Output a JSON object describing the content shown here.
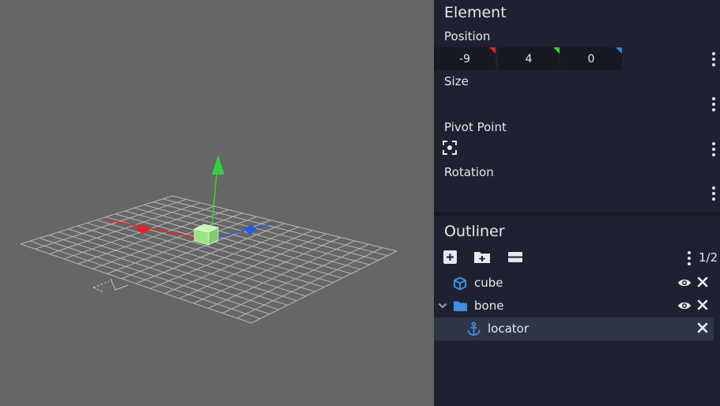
{
  "element_panel": {
    "title": "Element",
    "position": {
      "label": "Position",
      "x": "-9",
      "y": "4",
      "z": "0",
      "x_color": "#e0242d",
      "y_color": "#33d13f",
      "z_color": "#1f8fe6"
    },
    "size": {
      "label": "Size"
    },
    "pivot": {
      "label": "Pivot Point",
      "icon": "focus-pivot-icon"
    },
    "rotation": {
      "label": "Rotation"
    }
  },
  "outliner": {
    "title": "Outliner",
    "tools": [
      "add-cube-icon",
      "add-group-icon",
      "collapse-all-icon"
    ],
    "page_count": "1/2",
    "items": [
      {
        "label": "cube",
        "icon": "cube-icon",
        "visible": true
      },
      {
        "label": "bone",
        "icon": "folder-icon",
        "expanded": true,
        "visible": true
      },
      {
        "label": "locator",
        "icon": "anchor-icon",
        "selected": true
      }
    ]
  },
  "colors": {
    "panel_bg": "#1e2130",
    "viewport_bg": "#666666",
    "accent_blue": "#3f8ee0",
    "selection": "#2f3545"
  }
}
